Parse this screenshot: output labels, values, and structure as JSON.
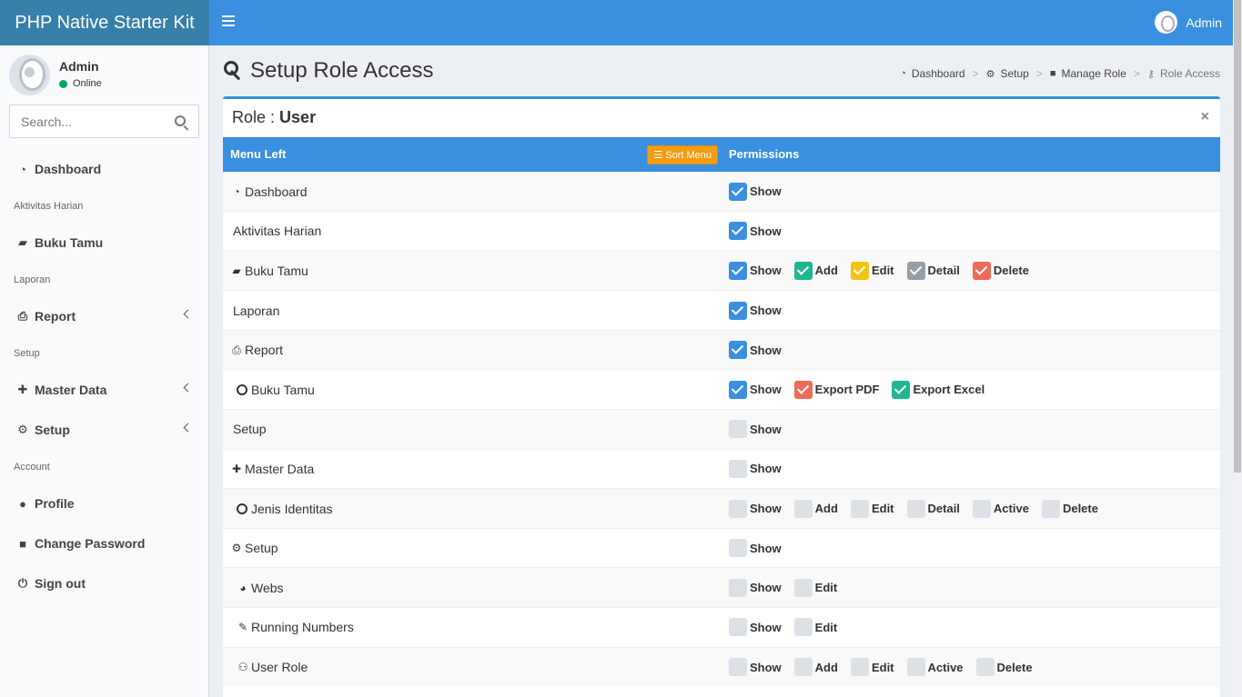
{
  "header": {
    "brand": "PHP Native Starter Kit",
    "user": "Admin"
  },
  "sidebar": {
    "user_name": "Admin",
    "status": "Online",
    "search_placeholder": "Search...",
    "items": [
      {
        "type": "item",
        "label": "Dashboard",
        "icon": "dashboard-icon",
        "glyph": "◔"
      },
      {
        "type": "header",
        "label": "Aktivitas Harian"
      },
      {
        "type": "item",
        "label": "Buku Tamu",
        "icon": "book-icon",
        "glyph": "▰"
      },
      {
        "type": "header",
        "label": "Laporan"
      },
      {
        "type": "item",
        "label": "Report",
        "icon": "print-icon",
        "glyph": "⎙",
        "chevron": true
      },
      {
        "type": "header",
        "label": "Setup"
      },
      {
        "type": "item",
        "label": "Master Data",
        "icon": "puzzle-icon",
        "glyph": "✚",
        "chevron": true
      },
      {
        "type": "item",
        "label": "Setup",
        "icon": "cogs-icon",
        "glyph": "⚙",
        "chevron": true
      },
      {
        "type": "header",
        "label": "Account"
      },
      {
        "type": "item",
        "label": "Profile",
        "icon": "user-icon",
        "glyph": "●"
      },
      {
        "type": "item",
        "label": "Change Password",
        "icon": "lock-icon",
        "glyph": "■"
      },
      {
        "type": "item",
        "label": "Sign out",
        "icon": "power-icon",
        "glyph": "⏻"
      }
    ]
  },
  "page": {
    "title": "Setup Role Access",
    "breadcrumb": [
      "Dashboard",
      "Setup",
      "Manage Role",
      "Role Access"
    ],
    "role_label": "Role :",
    "role_name": "User",
    "close": "×"
  },
  "table": {
    "col_menu": "Menu Left",
    "sort_button": "Sort Menu",
    "col_perms": "Permissions",
    "rows": [
      {
        "name": "Dashboard",
        "icon": "dashboard-icon",
        "glyph": "◔",
        "perms": [
          {
            "label": "Show",
            "on": true,
            "color": "blue"
          }
        ]
      },
      {
        "name": "Aktivitas Harian",
        "perms": [
          {
            "label": "Show",
            "on": true,
            "color": "blue"
          }
        ]
      },
      {
        "name": "Buku Tamu",
        "icon": "book-icon",
        "glyph": "▰",
        "perms": [
          {
            "label": "Show",
            "on": true,
            "color": "blue"
          },
          {
            "label": "Add",
            "on": true,
            "color": "green"
          },
          {
            "label": "Edit",
            "on": true,
            "color": "yellow"
          },
          {
            "label": "Detail",
            "on": true,
            "color": "gray"
          },
          {
            "label": "Delete",
            "on": true,
            "color": "red"
          }
        ]
      },
      {
        "name": "Laporan",
        "perms": [
          {
            "label": "Show",
            "on": true,
            "color": "blue"
          }
        ]
      },
      {
        "name": "Report",
        "icon": "print-icon",
        "glyph": "⎙",
        "perms": [
          {
            "label": "Show",
            "on": true,
            "color": "blue"
          }
        ]
      },
      {
        "name": "Buku Tamu",
        "icon": "circle-icon",
        "sub": true,
        "perms": [
          {
            "label": "Show",
            "on": true,
            "color": "blue"
          },
          {
            "label": "Export PDF",
            "on": true,
            "color": "red"
          },
          {
            "label": "Export Excel",
            "on": true,
            "color": "green"
          }
        ]
      },
      {
        "name": "Setup",
        "perms": [
          {
            "label": "Show",
            "on": false
          }
        ]
      },
      {
        "name": "Master Data",
        "icon": "puzzle-icon",
        "glyph": "✚",
        "perms": [
          {
            "label": "Show",
            "on": false
          }
        ]
      },
      {
        "name": "Jenis Identitas",
        "icon": "circle-icon",
        "sub": true,
        "perms": [
          {
            "label": "Show",
            "on": false
          },
          {
            "label": "Add",
            "on": false
          },
          {
            "label": "Edit",
            "on": false
          },
          {
            "label": "Detail",
            "on": false
          },
          {
            "label": "Active",
            "on": false
          },
          {
            "label": "Delete",
            "on": false
          }
        ]
      },
      {
        "name": "Setup",
        "icon": "cogs-icon",
        "glyph": "⚙",
        "perms": [
          {
            "label": "Show",
            "on": false
          }
        ]
      },
      {
        "name": "Webs",
        "icon": "globe-icon",
        "glyph": "◕",
        "sub": true,
        "perms": [
          {
            "label": "Show",
            "on": false
          },
          {
            "label": "Edit",
            "on": false
          }
        ]
      },
      {
        "name": "Running Numbers",
        "icon": "edit-icon",
        "glyph": "✎",
        "sub": true,
        "perms": [
          {
            "label": "Show",
            "on": false
          },
          {
            "label": "Edit",
            "on": false
          }
        ]
      },
      {
        "name": "User Role",
        "icon": "users-icon",
        "glyph": "⚇",
        "sub": true,
        "perms": [
          {
            "label": "Show",
            "on": false
          },
          {
            "label": "Add",
            "on": false
          },
          {
            "label": "Edit",
            "on": false
          },
          {
            "label": "Active",
            "on": false
          },
          {
            "label": "Delete",
            "on": false
          }
        ]
      }
    ]
  }
}
